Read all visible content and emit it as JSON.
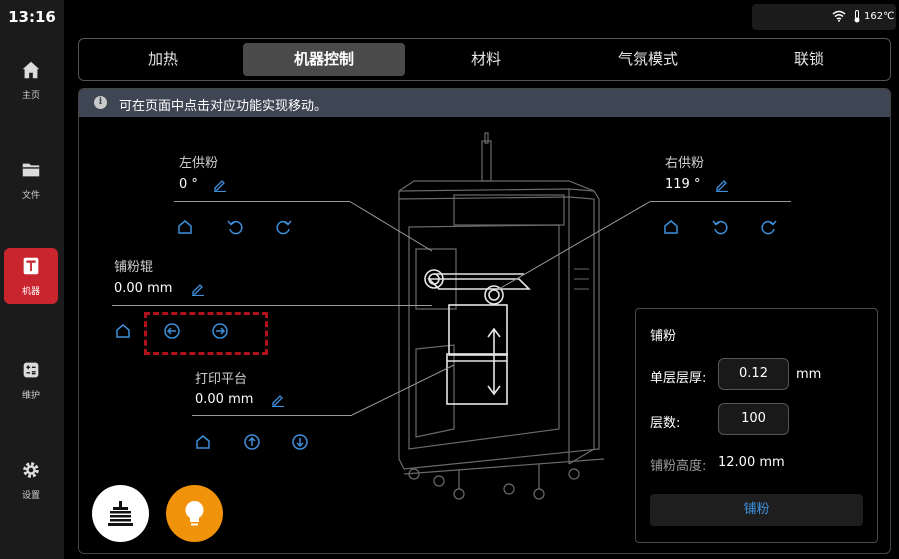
{
  "status": {
    "time": "13:16",
    "temperature": "162℃"
  },
  "sidebar": {
    "items": [
      {
        "label": "主页",
        "icon": "home-icon"
      },
      {
        "label": "文件",
        "icon": "folder-icon"
      },
      {
        "label": "机器",
        "icon": "machine-icon",
        "active": true
      },
      {
        "label": "维护",
        "icon": "maintenance-icon"
      },
      {
        "label": "设置",
        "icon": "gear-icon"
      }
    ]
  },
  "tabs": [
    {
      "label": "加热"
    },
    {
      "label": "机器控制",
      "active": true
    },
    {
      "label": "材料"
    },
    {
      "label": "气氛模式"
    },
    {
      "label": "联锁"
    }
  ],
  "info": {
    "text": "可在页面中点击对应功能实现移动。"
  },
  "left_feeder": {
    "label": "左供粉",
    "value": "0 °"
  },
  "right_feeder": {
    "label": "右供粉",
    "value": "119 °"
  },
  "roller": {
    "label": "铺粉辊",
    "value": "0.00 mm"
  },
  "platform": {
    "label": "打印平台",
    "value": "0.00 mm"
  },
  "powder_panel": {
    "title": "铺粉",
    "layer_thickness_label": "单层层厚:",
    "layer_thickness_value": "0.12",
    "layer_thickness_unit": "mm",
    "layer_count_label": "层数:",
    "layer_count_value": "100",
    "height_label": "铺粉高度:",
    "height_value": "12.00 mm",
    "button_label": "铺粉"
  },
  "colors": {
    "accent_blue": "#3d8fd9",
    "active_red": "#c8252f",
    "lamp_orange": "#f0930a"
  }
}
